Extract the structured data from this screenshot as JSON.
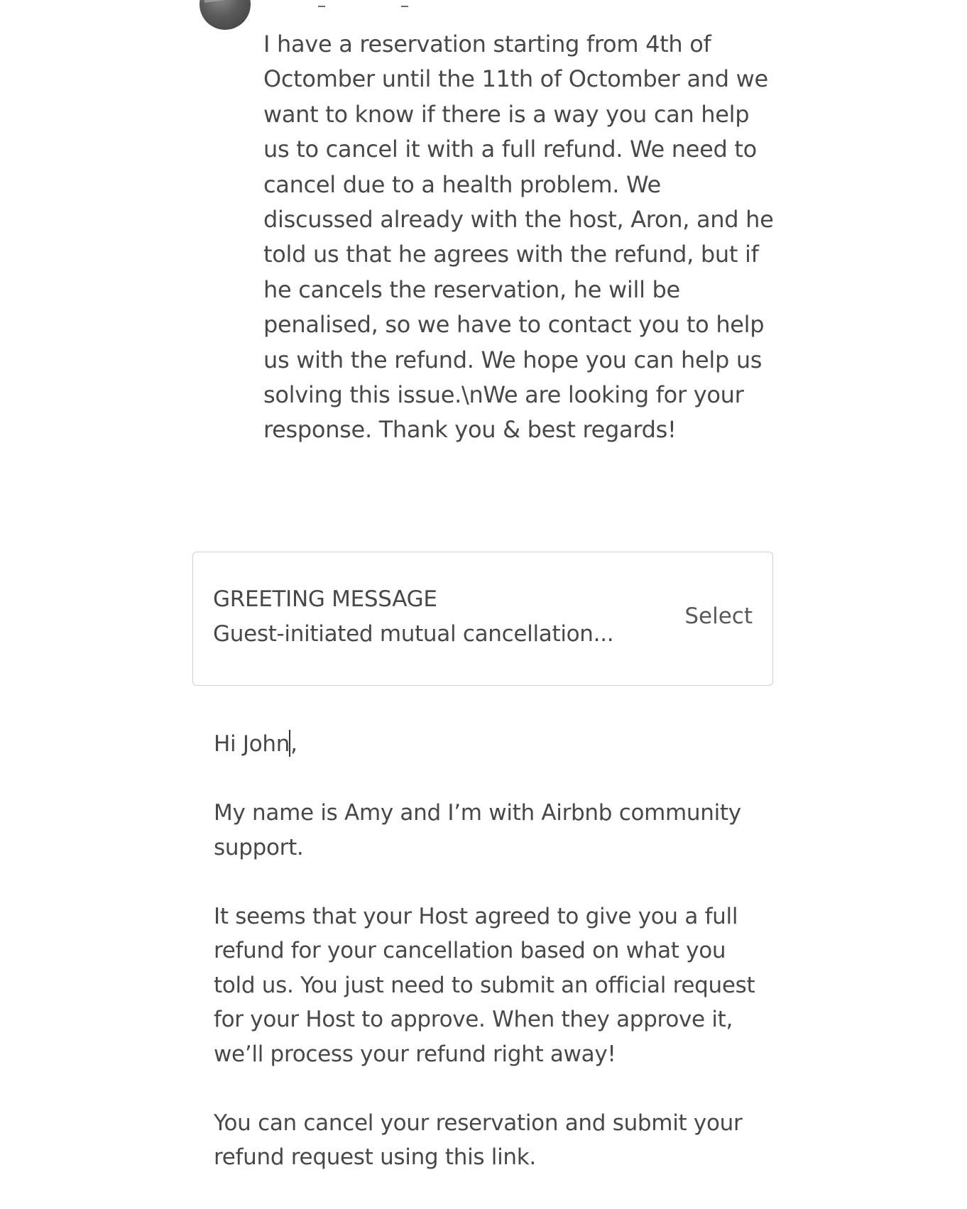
{
  "conversation": {
    "guest_message": "I have a reservation starting from 4th of Octomber until the 11th of Octomber and we want to know if there is a way you can help us to cancel it with a full refund. We need to cancel due to a health problem. We discussed already with the host, Aron, and he told us that he agrees with the refund, but if he cancels the reservation, he will be penalised, so we have to contact you to help us with the refund. We hope you can help us solving this issue.\\nWe are looking for your response. Thank you & best regards!"
  },
  "template": {
    "label": "GREETING MESSAGE",
    "value": "Guest-initiated mutual cancellation...",
    "select_label": "Select"
  },
  "reply": {
    "greeting_prefix": "Hi John",
    "greeting_suffix": ",",
    "intro": "My name is Amy and I’m with Airbnb community support.",
    "body": "It seems that your Host agreed to give you a full refund for your cancellation based on what you told us. You just need to submit an official request for your Host to approve.  When they approve it, we’ll process your refund right away!",
    "instructions": "You can cancel your reservation and submit your refund request using this link."
  }
}
